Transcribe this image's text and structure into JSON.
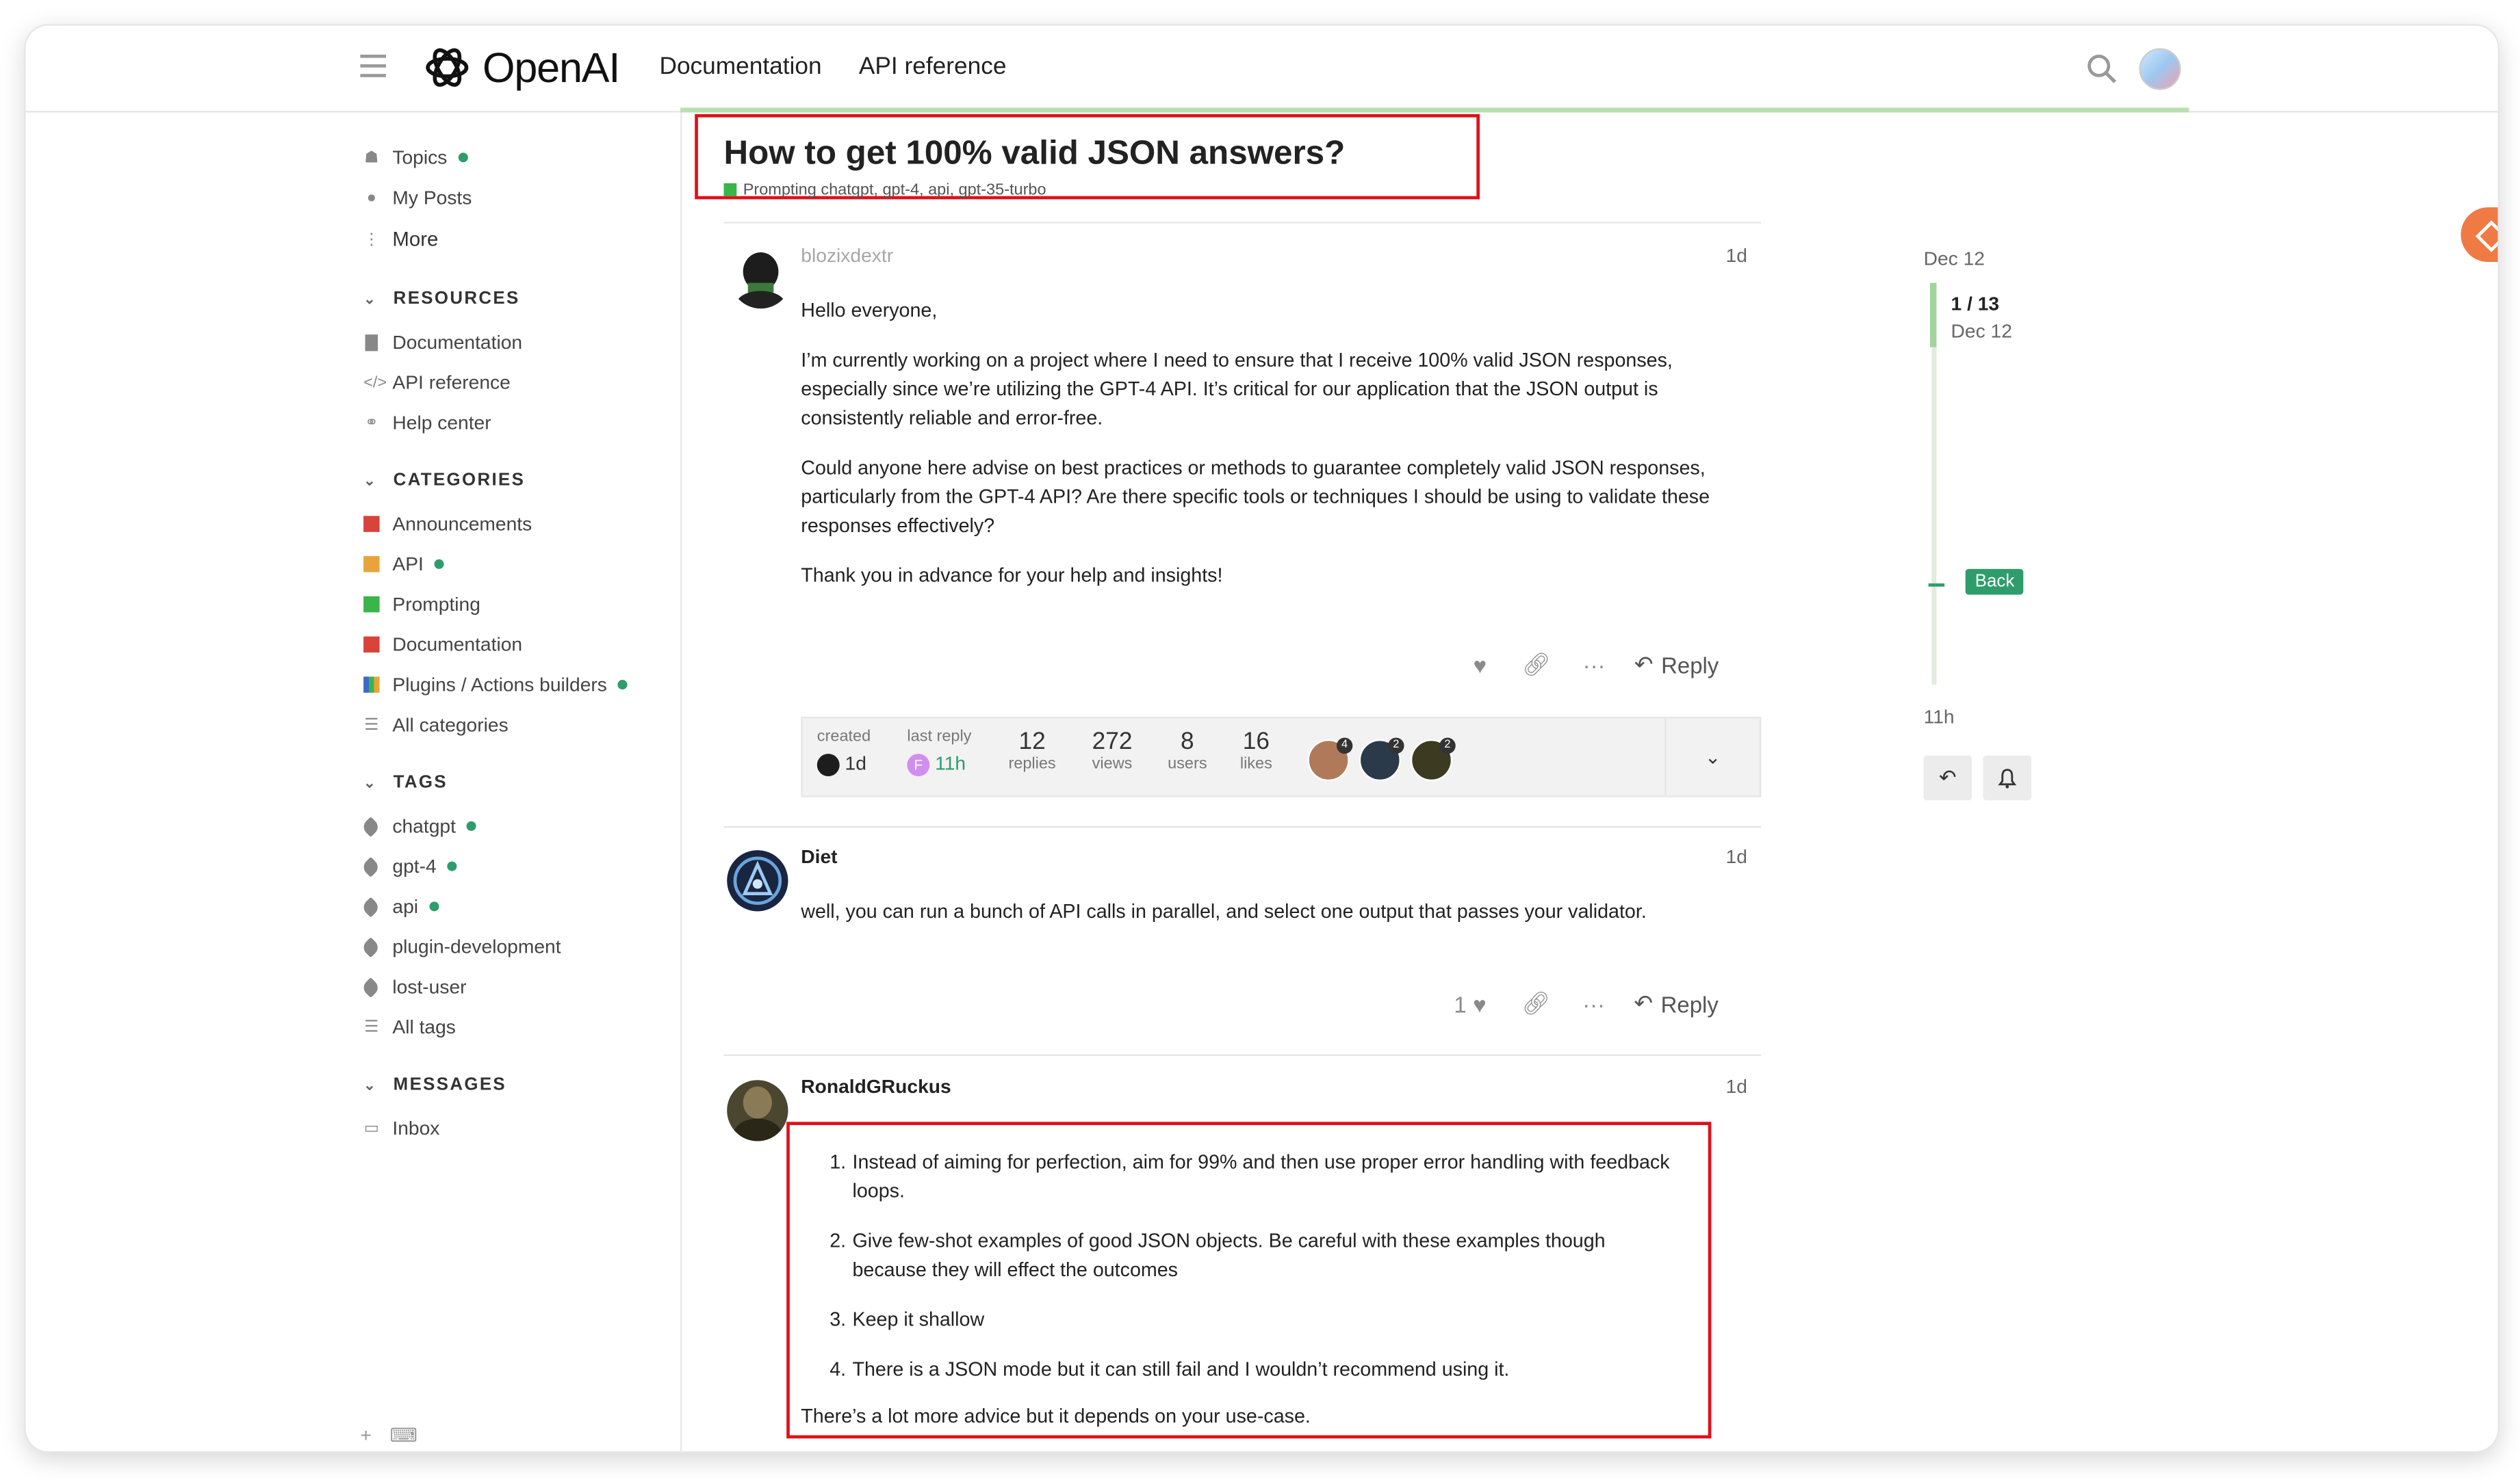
{
  "header": {
    "logo_text": "OpenAI",
    "nav": [
      "Documentation",
      "API reference"
    ]
  },
  "sidebar": {
    "top": [
      {
        "label": "Topics",
        "dot": true
      },
      {
        "label": "My Posts",
        "dot": false
      },
      {
        "label": "More",
        "dot": false
      }
    ],
    "resources": {
      "heading": "RESOURCES",
      "items": [
        "Documentation",
        "API reference",
        "Help center"
      ]
    },
    "categories": {
      "heading": "CATEGORIES",
      "items": [
        {
          "label": "Announcements",
          "color": "#d8433a",
          "dot": false
        },
        {
          "label": "API",
          "color": "#e8a43a",
          "dot": true
        },
        {
          "label": "Prompting",
          "color": "#3ab54a",
          "dot": false
        },
        {
          "label": "Documentation",
          "color": "#d8433a",
          "dot": false
        },
        {
          "label": "Plugins / Actions builders",
          "color": "#3b6ac8",
          "dot": true
        },
        {
          "label": "All categories",
          "color": "",
          "dot": false
        }
      ]
    },
    "tags": {
      "heading": "TAGS",
      "items": [
        {
          "label": "chatgpt",
          "dot": true
        },
        {
          "label": "gpt-4",
          "dot": true
        },
        {
          "label": "api",
          "dot": true
        },
        {
          "label": "plugin-development",
          "dot": false
        },
        {
          "label": "lost-user",
          "dot": false
        },
        {
          "label": "All tags",
          "dot": false
        }
      ]
    },
    "messages": {
      "heading": "MESSAGES",
      "items": [
        "Inbox"
      ]
    }
  },
  "topic": {
    "title": "How to get 100% valid JSON answers?",
    "tags_line": "Prompting  chatgpt, gpt-4, api, gpt-35-turbo"
  },
  "posts": [
    {
      "user": "blozixdextr",
      "date": "1d",
      "paragraphs": [
        "Hello everyone,",
        "I’m currently working on a project where I need to ensure that I receive 100% valid JSON responses, especially since we’re utilizing the GPT-4 API. It’s critical for our application that the JSON output is consistently reliable and error-free.",
        "Could anyone here advise on best practices or methods to guarantee completely valid JSON responses, particularly from the GPT-4 API? Are there specific tools or techniques I should be using to validate these responses effectively?",
        "Thank you in advance for your help and insights!"
      ],
      "reply_label": "Reply"
    },
    {
      "user": "Diet",
      "date": "1d",
      "paragraphs": [
        "well, you can run a bunch of API calls in parallel, and select one output that passes your validator."
      ],
      "likes": "1",
      "reply_label": "Reply"
    },
    {
      "user": "RonaldGRuckus",
      "date": "1d",
      "list": [
        "Instead of aiming for perfection, aim for 99% and then use proper error handling with feedback loops.",
        "Give few-shot examples of good JSON objects. Be careful with these examples though because they will effect the outcomes",
        "Keep it shallow",
        "There is a JSON mode but it can still fail and I wouldn’t recommend using it."
      ],
      "closing": "There’s a lot more advice but it depends on your use-case."
    }
  ],
  "meta": {
    "created_label": "created",
    "created_value": "1d",
    "last_reply_label": "last reply",
    "last_reply_value": "11h",
    "last_reply_initial": "F",
    "stats": [
      {
        "num": "12",
        "label": "replies"
      },
      {
        "num": "272",
        "label": "views"
      },
      {
        "num": "8",
        "label": "users"
      },
      {
        "num": "16",
        "label": "likes"
      }
    ],
    "avatar_badges": [
      "4",
      "2",
      "2"
    ]
  },
  "timeline": {
    "top_date": "Dec 12",
    "count": "1 / 13",
    "count_date": "Dec 12",
    "back_label": "Back",
    "bottom_date": "11h"
  }
}
